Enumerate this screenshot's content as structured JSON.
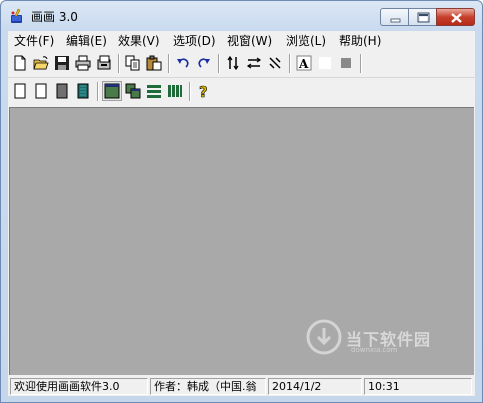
{
  "window": {
    "title": "画画 3.0",
    "controls": {
      "minimize": "minimize",
      "maximize": "maximize",
      "close": "close"
    }
  },
  "menu": [
    {
      "label": "文件(F)"
    },
    {
      "label": "编辑(E)"
    },
    {
      "label": "效果(V)"
    },
    {
      "label": "选项(D)"
    },
    {
      "label": "视窗(W)"
    },
    {
      "label": "浏览(L)"
    },
    {
      "label": "帮助(H)"
    }
  ],
  "toolbar1_icons": [
    "new-file-icon",
    "open-folder-icon",
    "save-icon",
    "print-icon",
    "print-setup-icon",
    "copy-icon",
    "paste-icon",
    "undo-icon",
    "redo-icon",
    "flip-vertical-icon",
    "flip-horizontal-icon",
    "rotate-icon",
    "text-tool-icon",
    "white-color-icon",
    "gray-color-icon"
  ],
  "toolbar2_icons": [
    "white-page-icon",
    "white-page-2-icon",
    "gray-page-icon",
    "teal-page-icon",
    "single-view-icon",
    "cascade-view-icon",
    "horizontal-tile-icon",
    "vertical-tile-icon",
    "help-icon"
  ],
  "statusbar": {
    "welcome": "欢迎使用画画软件3.0",
    "author": "作者：韩成（中国.翁",
    "date": "2014/1/2",
    "time": "10:31"
  },
  "watermark": {
    "text": "当下软件园",
    "sub": "downxia.com"
  },
  "colors": {
    "canvas": "#a9a9a9",
    "chrome": "#f0f0f0",
    "titlebar": "#c9daef",
    "close_button": "#c8402d"
  }
}
